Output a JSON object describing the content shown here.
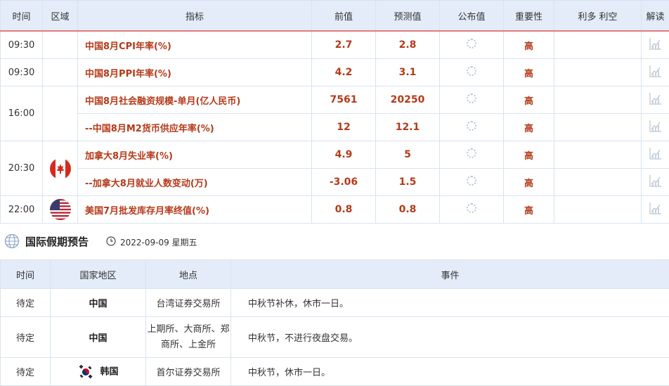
{
  "econ": {
    "headers": [
      "时间",
      "区域",
      "指标",
      "前值",
      "预测值",
      "公布值",
      "重要性",
      "利多 利空",
      "解读"
    ],
    "rows": [
      {
        "time": "09:30",
        "indicator": "中国8月CPI年率(%)",
        "prev": "2.7",
        "forecast": "2.8",
        "importance": "高"
      },
      {
        "time": "09:30",
        "indicator": "中国8月PPI年率(%)",
        "prev": "4.2",
        "forecast": "3.1",
        "importance": "高"
      },
      {
        "time": "16:00",
        "indicator": "中国8月社会融资规模-单月(亿人民币)",
        "prev": "7561",
        "forecast": "20250",
        "importance": "高"
      },
      {
        "time": "",
        "indicator": "--中国8月M2货币供应年率(%)",
        "prev": "12",
        "forecast": "12.1",
        "importance": "高"
      },
      {
        "time": "20:30",
        "indicator": "加拿大8月失业率(%)",
        "prev": "4.9",
        "forecast": "5",
        "importance": "高"
      },
      {
        "time": "",
        "indicator": "--加拿大8月就业人数变动(万)",
        "prev": "-3.06",
        "forecast": "1.5",
        "importance": "高"
      },
      {
        "time": "22:00",
        "indicator": "美国7月批发库存月率终值(%)",
        "prev": "0.8",
        "forecast": "0.8",
        "importance": "高"
      }
    ]
  },
  "holiday": {
    "title": "国际假期预告",
    "date": "2022-09-09 星期五",
    "headers": [
      "时间",
      "国家地区",
      "地点",
      "事件"
    ],
    "rows": [
      {
        "time": "待定",
        "country": "中国",
        "place": "台湾证券交易所",
        "event": "中秋节补休，休市一日。"
      },
      {
        "time": "待定",
        "country": "中国",
        "place": "上期所、大商所、郑商所、上金所",
        "event": "中秋节，不进行夜盘交易。"
      },
      {
        "time": "待定",
        "country": "韩国",
        "place": "首尔证券交易所",
        "event": "中秋节，休市一日。"
      }
    ]
  },
  "icons": {
    "status": "loading-spinner-icon",
    "interpret": "chart-icon",
    "flags": [
      "canada-flag",
      "usa-flag",
      "korea-flag"
    ]
  }
}
